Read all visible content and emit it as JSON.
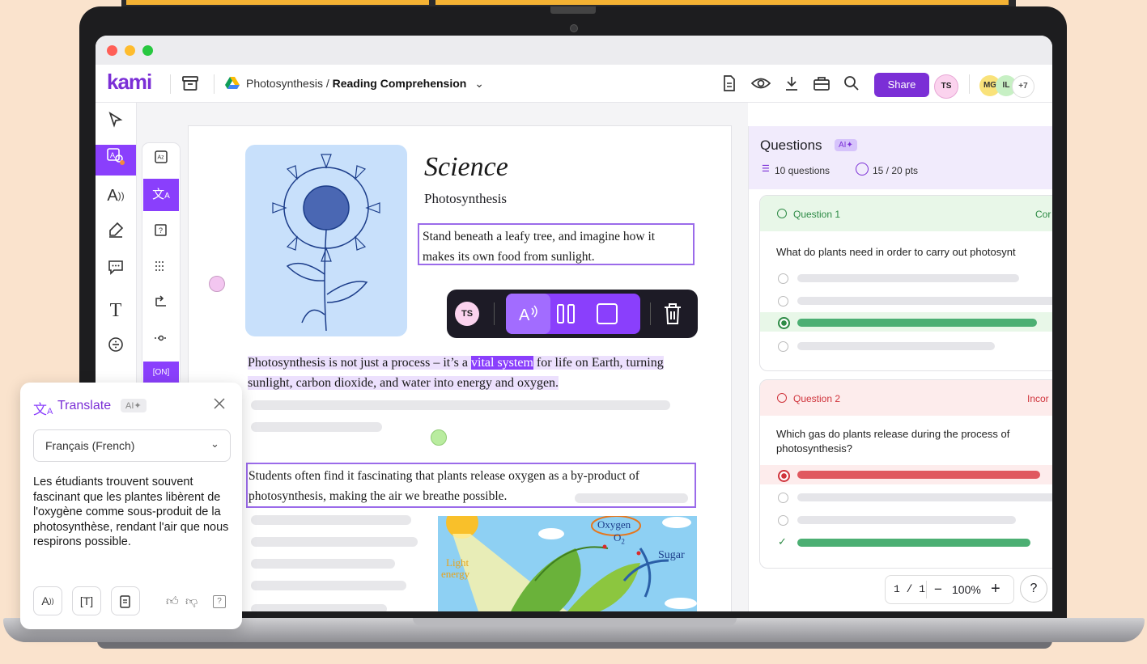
{
  "app": {
    "logo": "kami"
  },
  "breadcrumb": {
    "folder": "Photosynthesis",
    "separator": " / ",
    "file": "Reading Comprehension",
    "caret": "⌄"
  },
  "toolbar": {
    "share_label": "Share",
    "user_initials": "TS",
    "collaborators": [
      "MG",
      "IL"
    ],
    "more_count": "+7"
  },
  "document": {
    "title": "Science",
    "subtitle": "Photosynthesis",
    "intro": "Stand beneath a leafy tree, and imagine how it makes its own food from sunlight.",
    "para1_before": "Photosynthesis is not just a process – it’s a ",
    "para1_selected": "vital system",
    "para1_after": " for life on Earth, turning sunlight, carbon dioxide, and water into energy and oxygen.",
    "para2": "Students often find it fascinating that plants release oxygen as a by-product of photosynthesis, making the air we breathe possible.",
    "diagram": {
      "oxygen": "Oxygen",
      "o2": "O",
      "o2_sub": "2",
      "light": "Light",
      "energy": "energy",
      "sugar": "Sugar"
    }
  },
  "floatbar": {
    "user_initials": "TS"
  },
  "questions": {
    "title": "Questions",
    "ai_badge": "AI✦",
    "count_label": "10 questions",
    "points_label": "15 / 20 pts",
    "items": [
      {
        "label": "Question 1",
        "status": "Cor",
        "text": "What do plants need in order to carry out photosynt"
      },
      {
        "label": "Question 2",
        "status": "Incor",
        "text": "Which gas do plants release during the process of photosynthesis?"
      }
    ]
  },
  "zoom": {
    "page": "1 / 1",
    "minus": "−",
    "level": "100%",
    "plus": "+",
    "help": "?"
  },
  "translate": {
    "title": "Translate",
    "ai_badge": "AI✦",
    "language": "Français (French)",
    "text": "Les étudiants trouvent souvent fascinant que les plantes libèrent de l'oxygène comme sous-produit de la photosynthèse, rendant l'air que nous respirons possible."
  },
  "colors": {
    "accent": "#8a3ffc",
    "brand": "#7b2fd6",
    "correct": "#4caf73",
    "incorrect": "#e0585f"
  }
}
